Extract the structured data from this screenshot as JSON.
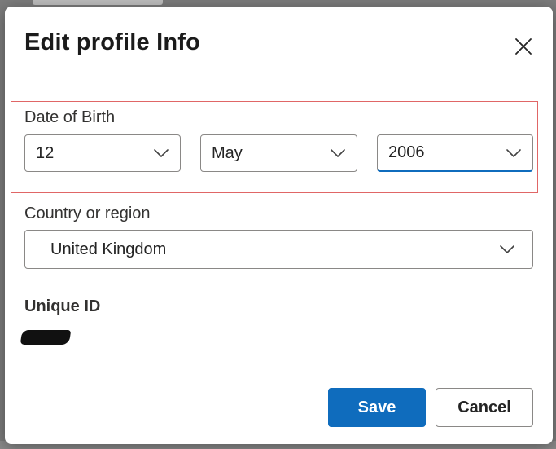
{
  "dialog": {
    "title": "Edit profile Info",
    "close_icon": "close-icon"
  },
  "date_of_birth": {
    "label": "Date of Birth",
    "day": "12",
    "month": "May",
    "year": "2006",
    "highlight_color": "#e06666"
  },
  "country": {
    "label": "Country or region",
    "value": "United Kingdom"
  },
  "unique_id": {
    "label": "Unique ID"
  },
  "actions": {
    "save_label": "Save",
    "cancel_label": "Cancel"
  },
  "colors": {
    "accent": "#0f6cbd",
    "border": "#8a8886",
    "text": "#242424"
  }
}
